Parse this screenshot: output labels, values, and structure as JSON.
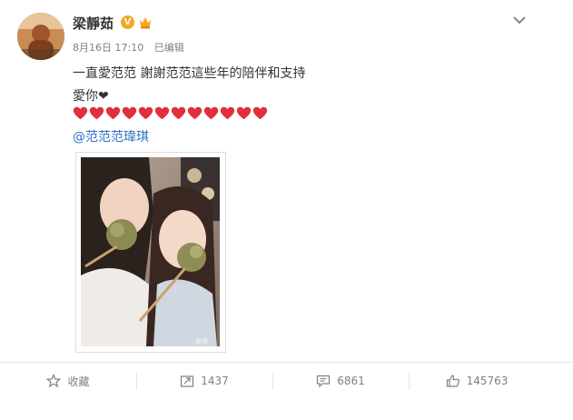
{
  "post": {
    "username": "梁靜茹",
    "verified_badge": "V",
    "date": "8月16日 17:10",
    "edited": "已编辑",
    "line1": "一直愛范范 謝謝范范這些年的陪伴和支持",
    "line2": "愛你❤",
    "heart_count": 12,
    "mention": "@范范范瑋琪",
    "photo_watermark": "微博"
  },
  "actions": {
    "favorite_label": "收藏",
    "repost_count": "1437",
    "comment_count": "6861",
    "like_count": "145763"
  },
  "icons": {
    "favorite": "star-outline-icon",
    "repost": "share-arrow-icon",
    "comment": "comment-bubble-icon",
    "like": "thumbs-up-icon",
    "menu": "chevron-down-icon"
  },
  "colors": {
    "accent": "#2f6fc4",
    "verified": "#f5a623",
    "heart": "#e0303a",
    "muted": "#808080"
  }
}
